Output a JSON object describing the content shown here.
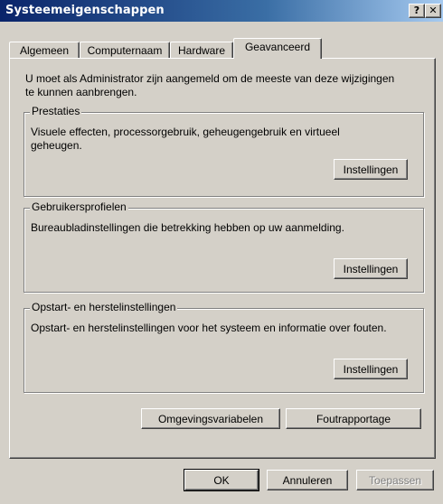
{
  "window": {
    "title": "Systeemeigenschappen",
    "help_glyph": "?",
    "close_glyph": "✕"
  },
  "tabs": [
    {
      "label": "Algemeen",
      "active": false
    },
    {
      "label": "Computernaam",
      "active": false
    },
    {
      "label": "Hardware",
      "active": false
    },
    {
      "label": "Geavanceerd",
      "active": true
    }
  ],
  "intro": "U moet als Administrator zijn aangemeld om de meeste van deze wijzigingen te kunnen aanbrengen.",
  "groups": [
    {
      "title": "Prestaties",
      "description": "Visuele effecten, processorgebruik, geheugengebruik en virtueel geheugen.",
      "button": "Instellingen"
    },
    {
      "title": "Gebruikersprofielen",
      "description": "Bureaubladinstellingen die betrekking hebben op uw aanmelding.",
      "button": "Instellingen"
    },
    {
      "title": "Opstart- en herstelinstellingen",
      "description": "Opstart- en herstelinstellingen voor het systeem en informatie over fouten.",
      "button": "Instellingen"
    }
  ],
  "extra_buttons": {
    "env_vars": "Omgevingsvariabelen",
    "error_report": "Foutrapportage"
  },
  "footer": {
    "ok": "OK",
    "cancel": "Annuleren",
    "apply": "Toepassen"
  },
  "colors": {
    "titlebar_start": "#0a246a",
    "titlebar_end": "#a6caf0",
    "face": "#d4d0c8"
  }
}
